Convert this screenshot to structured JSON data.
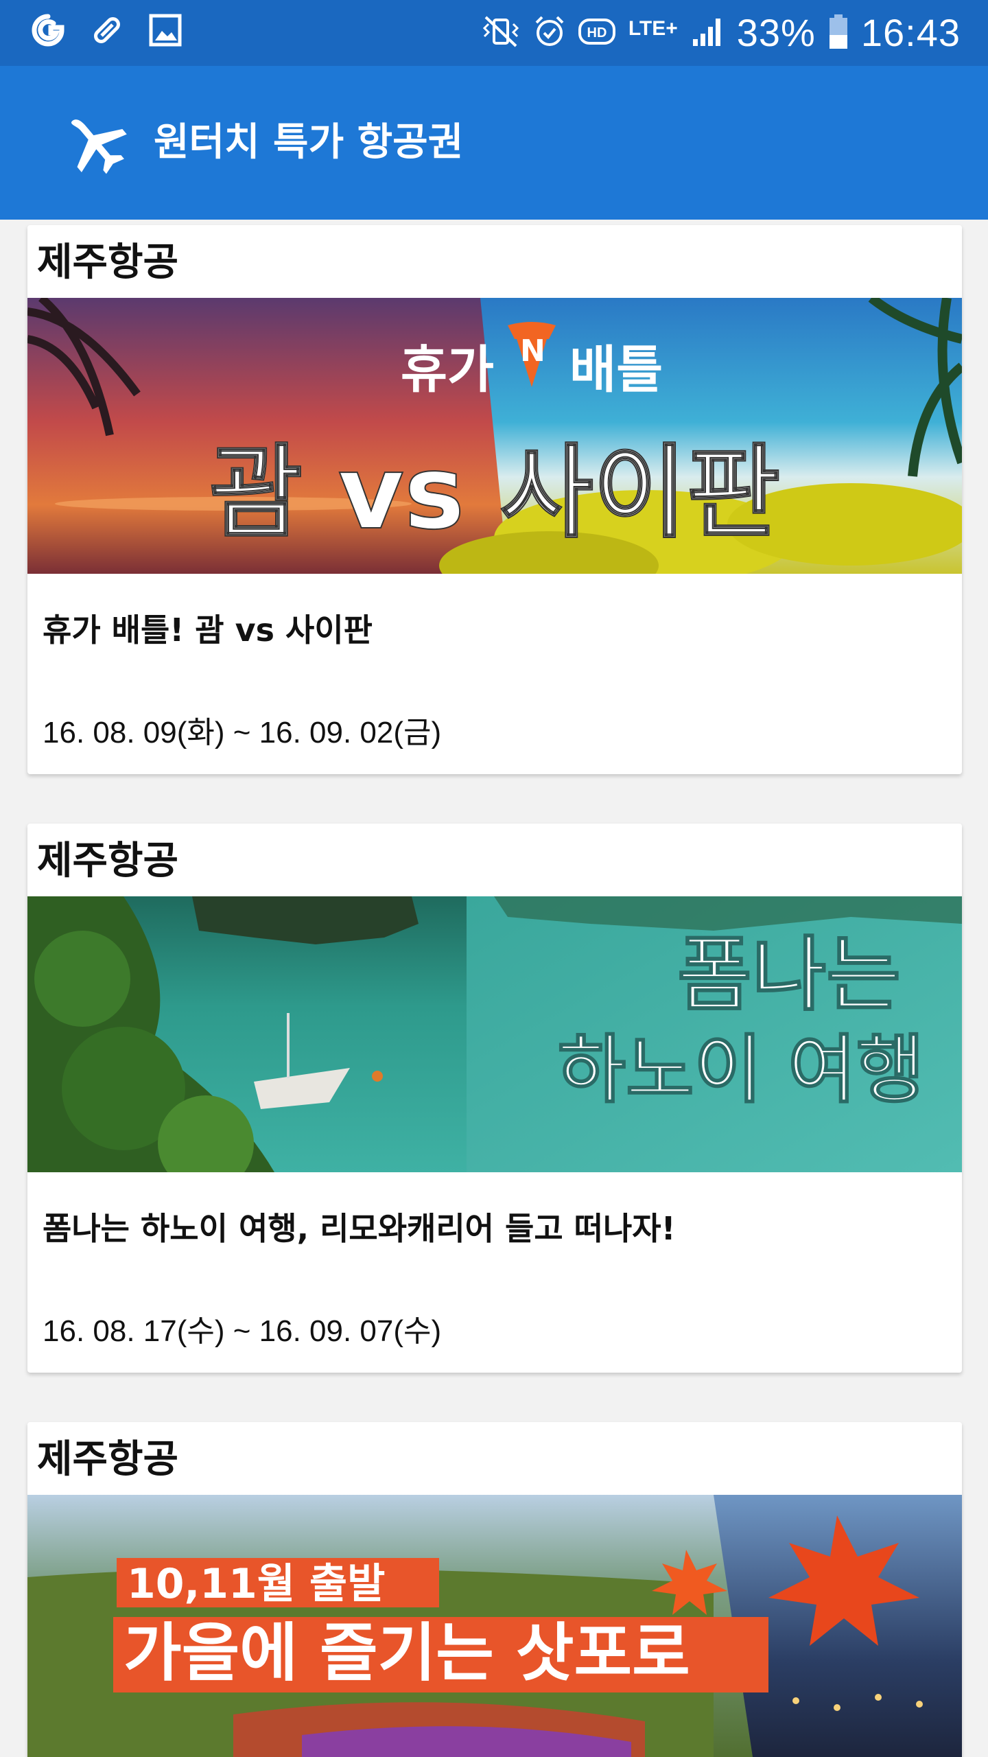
{
  "status_bar": {
    "battery": "33%",
    "time": "16:43",
    "network": "LTE+",
    "icons": [
      "g-icon",
      "bandage-icon",
      "image-icon",
      "vibrate-off-icon",
      "alarm-icon",
      "hd-icon",
      "lte-icon",
      "signal-icon",
      "battery-icon"
    ]
  },
  "app_bar": {
    "title": "원터치 특가 항공권",
    "icon": "airplane-icon"
  },
  "colors": {
    "status_bar": "#1a68c0",
    "app_bar": "#1e78d6",
    "background": "#f2f2f2"
  },
  "deals": [
    {
      "airline": "제주항공",
      "banner": {
        "line1": "휴가",
        "badge": "N",
        "line1b": "배틀",
        "line2": "괌 vs 사이판"
      },
      "title": "휴가 배틀! 괌 vs 사이판",
      "dates": "16. 08. 09(화) ~ 16. 09. 02(금)"
    },
    {
      "airline": "제주항공",
      "banner": {
        "line1": "폼나는",
        "line2": "하노이 여행"
      },
      "title": "폼나는 하노이 여행, 리모와캐리어 들고 떠나자!",
      "dates": "16. 08. 17(수) ~ 16. 09. 07(수)"
    },
    {
      "airline": "제주항공",
      "banner": {
        "line1": "10,11월 출발",
        "line2": "가을에 즐기는 삿포로"
      }
    }
  ]
}
